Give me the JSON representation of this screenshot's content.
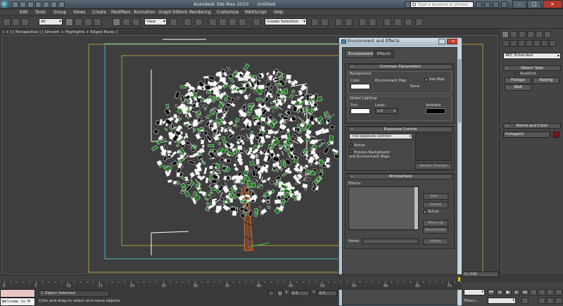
{
  "window": {
    "app_title": "Autodesk 3ds Max 2010",
    "doc_title": "Untitled",
    "search_placeholder": "Type a keyword or phrase"
  },
  "menu": [
    "Edit",
    "Tools",
    "Group",
    "Views",
    "Create",
    "Modifiers",
    "Animation",
    "Graph Editors",
    "Rendering",
    "Customize",
    "MAXScript",
    "Help"
  ],
  "toolbar": {
    "selection_filter": "All",
    "ref_coord": "View",
    "named_selection": "Create Selection"
  },
  "viewport": {
    "label": "[ + ] [ Perspective ] [ Smooth + Highlights + Edged Faces ]"
  },
  "command_panel": {
    "category": "AEC Extended",
    "object_type_title": "Object Type",
    "autogrid": "AutoGrid",
    "buttons": [
      "Foliage",
      "Railing",
      "Wall"
    ],
    "name_color_title": "Name and Color",
    "object_name": "Foliage01"
  },
  "dialog": {
    "title": "Environment and Effects",
    "tabs": [
      "Environment",
      "Effects"
    ],
    "common": {
      "title": "Common Parameters",
      "background_label": "Background:",
      "color_label": "Color:",
      "env_map_label": "Environment Map:",
      "use_map_label": "Use Map",
      "env_map_value": "None",
      "global_lighting_label": "Global Lighting:",
      "tint_label": "Tint:",
      "level_label": "Level:",
      "level_value": "1.0",
      "ambient_label": "Ambient:"
    },
    "exposure": {
      "title": "Exposure Control",
      "dropdown": "<no exposure control>",
      "active_label": "Active",
      "process_bg_label": "Process Background and Environment Maps",
      "render_preview": "Render Preview"
    },
    "atmosphere": {
      "title": "Atmosphere",
      "effects_label": "Effects:",
      "add": "Add...",
      "delete": "Delete",
      "active": "Active",
      "move_up": "Move Up",
      "move_down": "Move Down",
      "name_label": "Name:",
      "merge": "Merge"
    }
  },
  "timeline": {
    "slider_text": "0 / 100",
    "ruler_labels": [
      "0",
      "5",
      "10",
      "15",
      "20",
      "25",
      "30",
      "35",
      "40",
      "45",
      "50",
      "55",
      "60",
      "65",
      "70"
    ]
  },
  "status": {
    "welcome": "Welcome to M",
    "selected": "1 Object Selected",
    "prompt": "Click and drag to select and move objects",
    "x_label": "X:",
    "x_value": "0.0",
    "y_label": "Y:",
    "y_value": "0.0",
    "filters": "Filters..."
  },
  "colors": {
    "accent": "#5c6a78",
    "foliage_green": "#1f7a1f",
    "object_color": "#8a1010"
  }
}
